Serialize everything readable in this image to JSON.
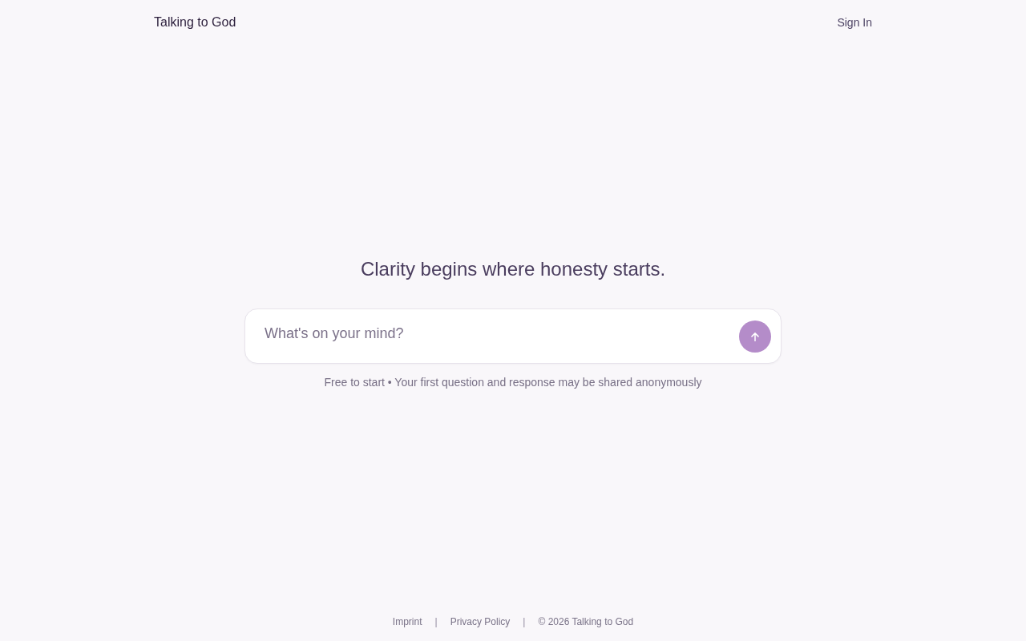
{
  "header": {
    "brand": "Talking to God",
    "sign_in": "Sign In"
  },
  "hero": {
    "heading": "Clarity begins where honesty starts.",
    "prompt": {
      "placeholder": "What's on your mind?"
    },
    "note": "Free to start • Your first question and response may be shared anonymously"
  },
  "footer": {
    "links": [
      "Imprint",
      "Privacy Policy"
    ],
    "separators": [
      "|",
      "|"
    ],
    "copyright": "© 2026 Talking to God"
  }
}
